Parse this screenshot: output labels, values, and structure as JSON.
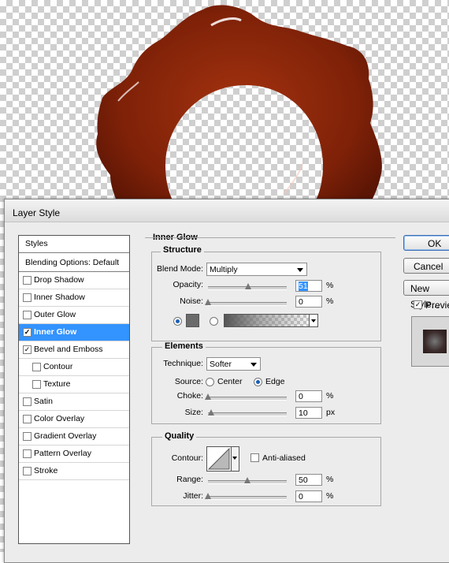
{
  "dialog": {
    "title": "Layer Style",
    "styles_header": "Styles",
    "blending_options": "Blending Options: Default",
    "styles": [
      {
        "label": "Drop Shadow",
        "checked": false,
        "selected": false,
        "indent": false
      },
      {
        "label": "Inner Shadow",
        "checked": false,
        "selected": false,
        "indent": false
      },
      {
        "label": "Outer Glow",
        "checked": false,
        "selected": false,
        "indent": false
      },
      {
        "label": "Inner Glow",
        "checked": true,
        "selected": true,
        "indent": false
      },
      {
        "label": "Bevel and Emboss",
        "checked": true,
        "selected": false,
        "indent": false
      },
      {
        "label": "Contour",
        "checked": false,
        "selected": false,
        "indent": true
      },
      {
        "label": "Texture",
        "checked": false,
        "selected": false,
        "indent": true
      },
      {
        "label": "Satin",
        "checked": false,
        "selected": false,
        "indent": false
      },
      {
        "label": "Color Overlay",
        "checked": false,
        "selected": false,
        "indent": false
      },
      {
        "label": "Gradient Overlay",
        "checked": false,
        "selected": false,
        "indent": false
      },
      {
        "label": "Pattern Overlay",
        "checked": false,
        "selected": false,
        "indent": false
      },
      {
        "label": "Stroke",
        "checked": false,
        "selected": false,
        "indent": false
      }
    ],
    "panel_title": "Inner Glow",
    "structure": {
      "title": "Structure",
      "blend_mode_label": "Blend Mode:",
      "blend_mode_value": "Multiply",
      "opacity_label": "Opacity:",
      "opacity_value": "51",
      "opacity_level": 51,
      "noise_label": "Noise:",
      "noise_value": "0",
      "noise_level": 0,
      "percent": "%",
      "color_swatch": "#6b6b6b"
    },
    "elements": {
      "title": "Elements",
      "technique_label": "Technique:",
      "technique_value": "Softer",
      "source_label": "Source:",
      "source_center": "Center",
      "source_edge": "Edge",
      "choke_label": "Choke:",
      "choke_value": "0",
      "choke_level": 0,
      "size_label": "Size:",
      "size_value": "10",
      "size_level": 4,
      "percent": "%",
      "px": "px"
    },
    "quality": {
      "title": "Quality",
      "contour_label": "Contour:",
      "anti_aliased_label": "Anti-aliased",
      "range_label": "Range:",
      "range_value": "50",
      "range_level": 50,
      "jitter_label": "Jitter:",
      "jitter_value": "0",
      "jitter_level": 0,
      "percent": "%"
    },
    "buttons": {
      "ok": "OK",
      "cancel": "Cancel",
      "new_style": "New Style...",
      "preview_label": "Preview"
    }
  },
  "colors": {
    "selection": "#3393ff",
    "ring": "#8a2408"
  }
}
